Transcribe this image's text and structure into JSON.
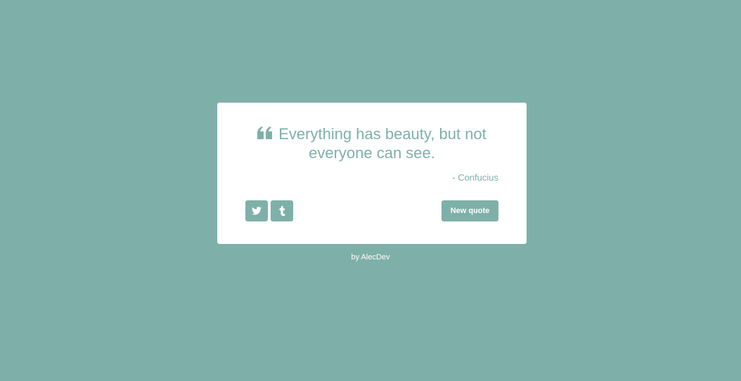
{
  "colors": {
    "accent": "#7eb0a9",
    "card_background": "#ffffff",
    "text_on_accent": "#ffffff"
  },
  "quote": {
    "icon": "quote-left-icon",
    "text": "Everything has beauty, but not everyone can see.",
    "author": "- Confucius"
  },
  "actions": {
    "twitter_icon": "twitter-icon",
    "tumblr_icon": "tumblr-icon",
    "new_quote_label": "New quote"
  },
  "footer": {
    "prefix": "by ",
    "author": "AlecDev"
  }
}
